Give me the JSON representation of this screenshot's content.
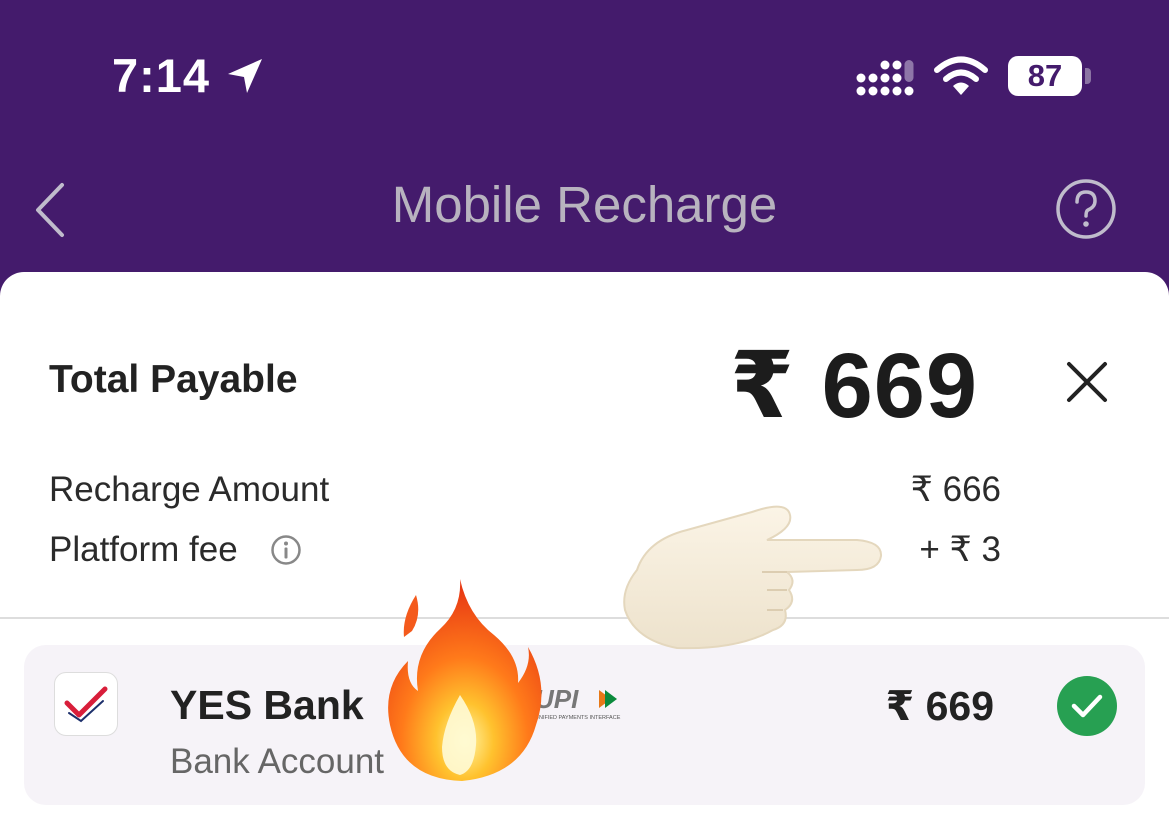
{
  "status_bar": {
    "time": "7:14",
    "battery": "87"
  },
  "header": {
    "title": "Mobile Recharge"
  },
  "summary": {
    "total_label": "Total Payable",
    "total_amount": "₹ 669",
    "recharge_label": "Recharge Amount",
    "recharge_value": "₹ 666",
    "fee_label": "Platform fee",
    "fee_value": "+ ₹ 3"
  },
  "payment": {
    "bank_name": "YES Bank",
    "account_type": "Bank Account",
    "amount": "₹ 669",
    "upi_text": "UPI",
    "upi_subtext": "UNIFIED PAYMENTS INTERFACE"
  },
  "colors": {
    "header_bg": "#441b6c",
    "check": "#27a052",
    "bank_red": "#d81e3a"
  },
  "icons": [
    "location-arrow-icon",
    "signal-icon",
    "wifi-icon",
    "back-icon",
    "help-icon",
    "close-icon",
    "info-icon",
    "checkmark-icon",
    "pointing-hand-icon",
    "fire-icon"
  ]
}
